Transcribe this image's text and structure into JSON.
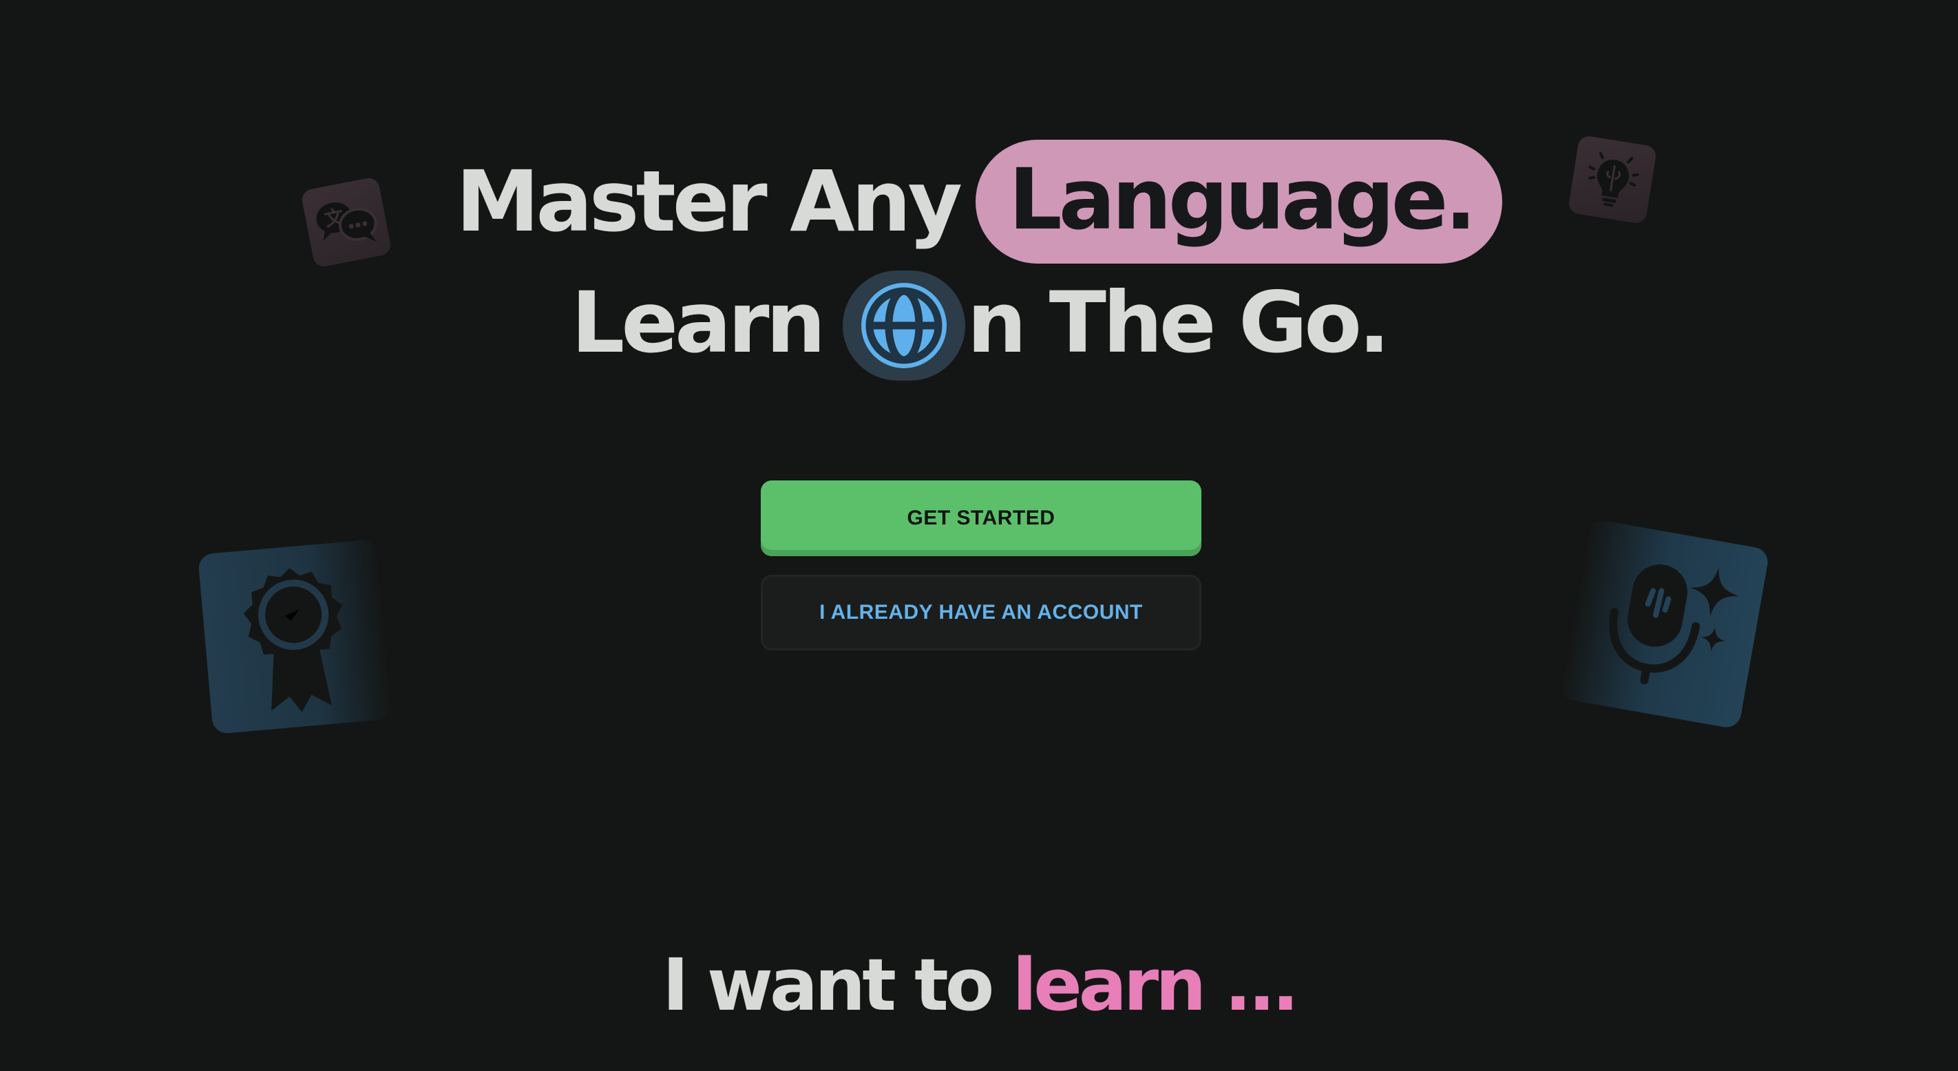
{
  "hero": {
    "line1_prefix": "Master Any",
    "line1_highlight": "Language.",
    "line2_prefix": "Learn",
    "line2_suffix": "n The Go."
  },
  "buttons": {
    "get_started": "GET STARTED",
    "have_account": "I ALREADY HAVE AN ACCOUNT"
  },
  "learn_prompt": {
    "prefix": "I want to",
    "accent": "learn ..."
  },
  "icons": {
    "globe": "globe-icon",
    "translate": "translate-chat-icon",
    "idea": "brain-lightbulb-icon",
    "badge": "award-badge-icon",
    "mic": "ai-microphone-icon"
  },
  "colors": {
    "background": "#141615",
    "primary_button": "#5cc06a",
    "secondary_text": "#63b2ea",
    "highlight_pill": "#cf98b7",
    "accent_pink": "#e87fb9",
    "globe_blue": "#5eb0ec"
  }
}
